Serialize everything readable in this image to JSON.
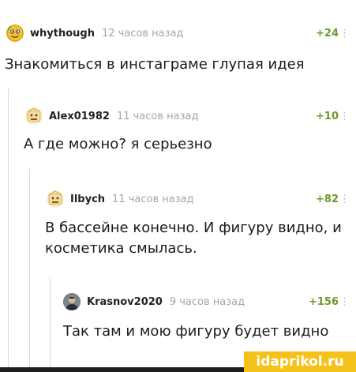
{
  "comments": [
    {
      "user": "whythough",
      "time": "12 часов назад",
      "rating": "+24",
      "text": "Знакомиться в инстаграме глупая идея",
      "more": "⋮"
    },
    {
      "user": "Alex01982",
      "time": "11 часов назад",
      "rating": "+10",
      "text": "А где можно? я серьезно",
      "more": "⋮"
    },
    {
      "user": "Ilbych",
      "time": "11 часов назад",
      "rating": "+82",
      "text": "В бассейне конечно. И фигуру видно, и косметика смылась.",
      "more": "⋮"
    },
    {
      "user": "Krasnov2020",
      "time": "9 часов назад",
      "rating": "+156",
      "text": "Так там и мою фигуру будет видно",
      "more": "⋮"
    }
  ],
  "watermark": "idaprikol.ru",
  "colors": {
    "rating": "#6b9a2c",
    "watermark_bg": "#f5c21b",
    "time": "#a6a6a6",
    "thread_line": "#d9d9d9"
  }
}
